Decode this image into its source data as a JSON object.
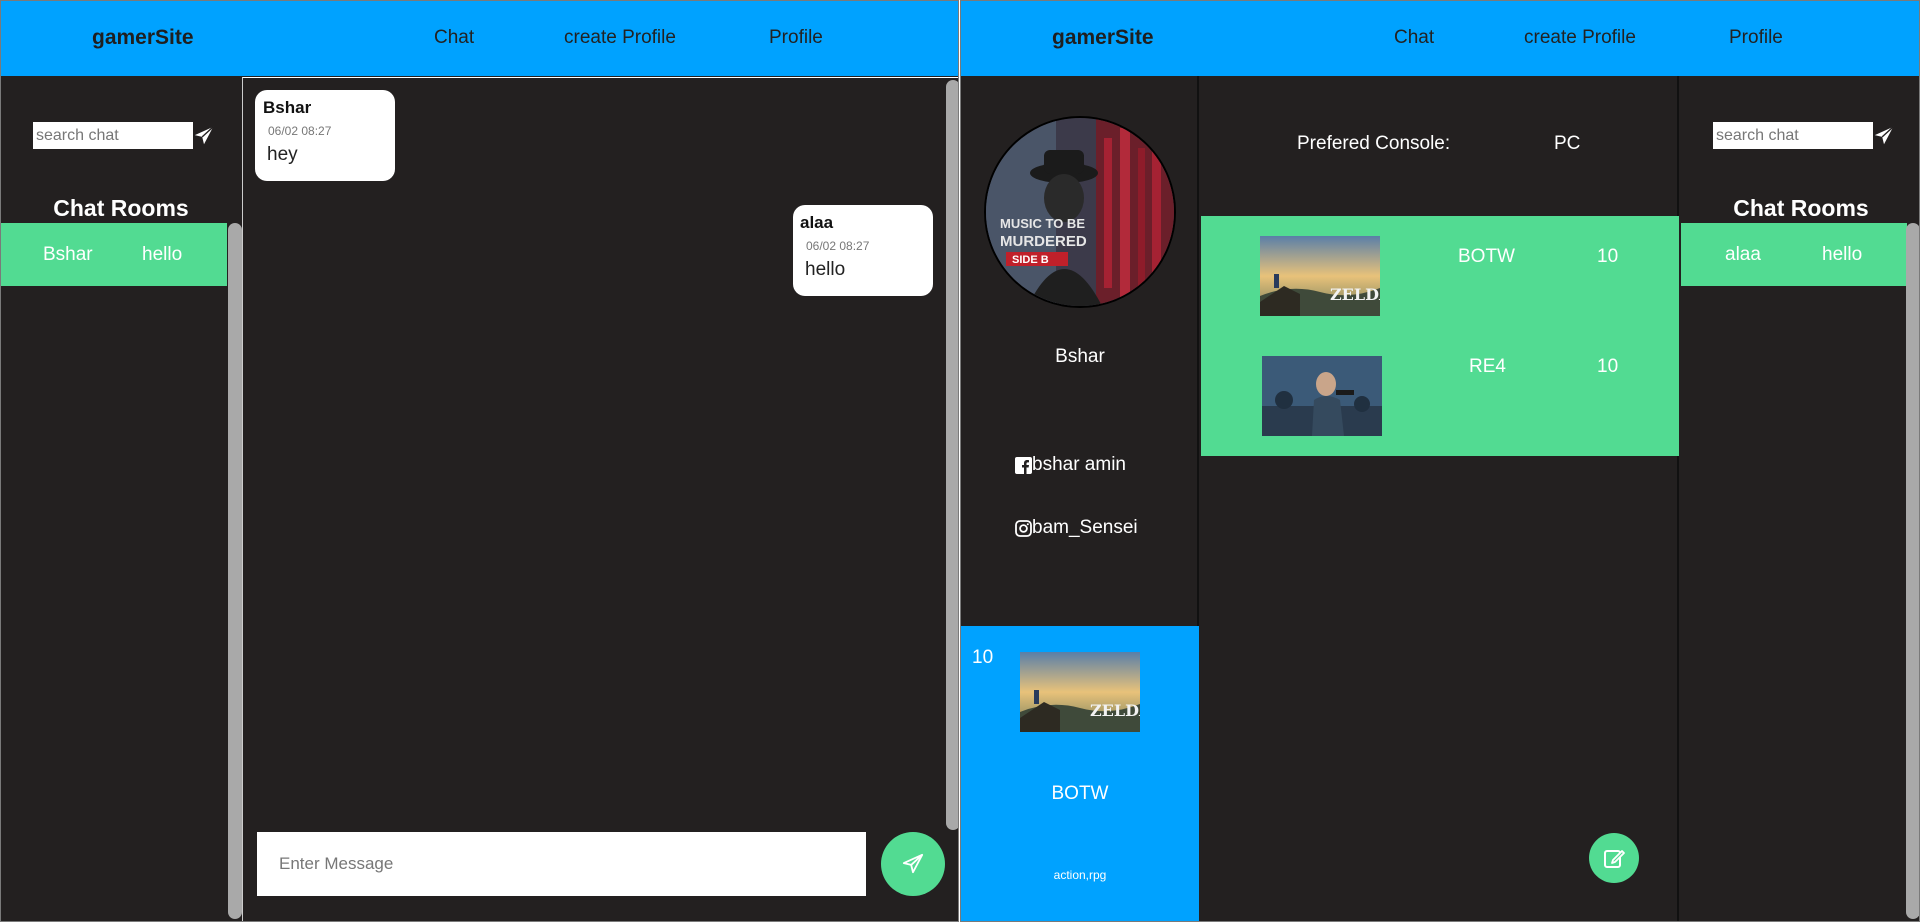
{
  "left_window": {
    "navbar": {
      "brand": "gamerSite",
      "links": [
        "Chat",
        "create Profile",
        "Profile"
      ]
    },
    "sidebar": {
      "search_placeholder": "search chat",
      "rooms_title": "Chat Rooms",
      "rooms": [
        {
          "name": "Bshar",
          "last_message": "hello"
        }
      ]
    },
    "messages": [
      {
        "user": "Bshar",
        "time": "06/02 08:27",
        "text": "hey",
        "align": "left"
      },
      {
        "user": "alaa",
        "time": "06/02 08:27",
        "text": "hello",
        "align": "right"
      }
    ],
    "composer": {
      "placeholder": "Enter Message"
    }
  },
  "right_window": {
    "navbar": {
      "brand": "gamerSite",
      "links": [
        "Chat",
        "create Profile",
        "Profile"
      ]
    },
    "profile": {
      "name": "Bshar",
      "facebook": "bshar amin",
      "instagram": "bam_Sensei",
      "favorite": {
        "score": "10",
        "title": "BOTW",
        "genre": "action,rpg"
      }
    },
    "games": {
      "console_label": "Prefered Console:",
      "console_value": "PC",
      "items": [
        {
          "name": "BOTW",
          "score": "10"
        },
        {
          "name": "RE4",
          "score": "10"
        }
      ]
    },
    "sidebar": {
      "search_placeholder": "search chat",
      "rooms_title": "Chat Rooms",
      "rooms": [
        {
          "name": "alaa",
          "last_message": "hello"
        }
      ]
    }
  },
  "colors": {
    "nav_blue": "#00a2ff",
    "accent_green": "#52db92",
    "dark_bg": "#232020"
  },
  "icons": [
    "send-icon",
    "facebook-icon",
    "instagram-icon",
    "edit-icon"
  ]
}
